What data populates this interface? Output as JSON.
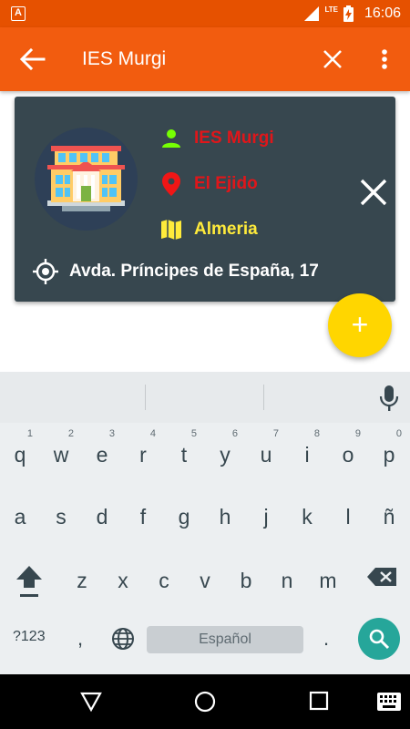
{
  "status_bar": {
    "app_badge": "A",
    "network": "LTE",
    "time": "16:06"
  },
  "app_bar": {
    "title": "IES Murgi",
    "back_icon": "arrow-left-icon",
    "clear_icon": "close-icon",
    "more_icon": "more-vert-icon"
  },
  "card": {
    "name": "IES Murgi",
    "city": "El Ejido",
    "province": "Almeria",
    "address": "Avda. Príncipes de España, 17",
    "colors": {
      "name": "#e0161a",
      "city": "#e0161a",
      "province": "#ffeb3b",
      "person_icon": "#76ff03",
      "pin_icon": "#f01616",
      "map_icon": "#ffeb3b"
    }
  },
  "fab": {
    "label": "+"
  },
  "keyboard": {
    "row1": [
      {
        "ch": "q",
        "hint": "1"
      },
      {
        "ch": "w",
        "hint": "2"
      },
      {
        "ch": "e",
        "hint": "3"
      },
      {
        "ch": "r",
        "hint": "4"
      },
      {
        "ch": "t",
        "hint": "5"
      },
      {
        "ch": "y",
        "hint": "6"
      },
      {
        "ch": "u",
        "hint": "7"
      },
      {
        "ch": "i",
        "hint": "8"
      },
      {
        "ch": "o",
        "hint": "9"
      },
      {
        "ch": "p",
        "hint": "0"
      }
    ],
    "row2": [
      "a",
      "s",
      "d",
      "f",
      "g",
      "h",
      "j",
      "k",
      "l",
      "ñ"
    ],
    "row3": [
      "z",
      "x",
      "c",
      "v",
      "b",
      "n",
      "m"
    ],
    "symbols_key": "?123",
    "comma_key": ",",
    "period_key": ".",
    "space_label": "Español"
  }
}
